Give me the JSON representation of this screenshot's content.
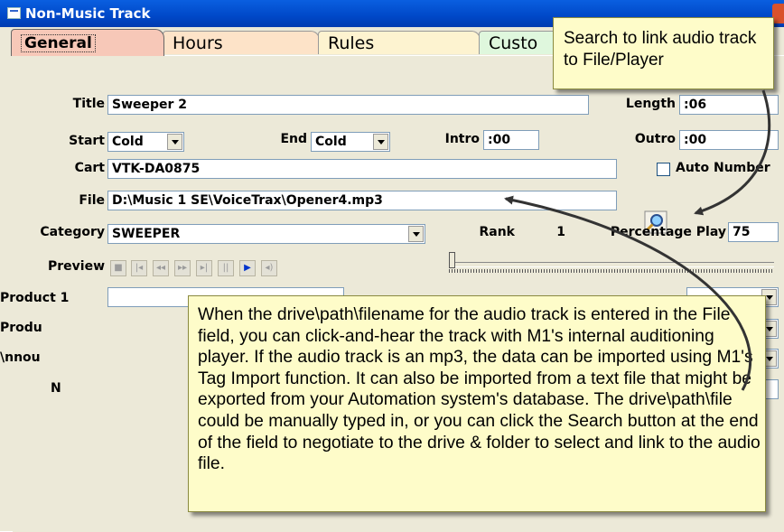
{
  "window": {
    "title": "Non-Music Track"
  },
  "tabs": [
    {
      "label": "General"
    },
    {
      "label": "Hours"
    },
    {
      "label": "Rules"
    },
    {
      "label": "Custo"
    }
  ],
  "form": {
    "title_label": "Title",
    "title_value": "Sweeper 2",
    "length_label": "Length",
    "length_value": ":06",
    "start_label": "Start",
    "start_value": "Cold",
    "end_label": "End",
    "end_value": "Cold",
    "intro_label": "Intro",
    "intro_value": ":00",
    "outro_label": "Outro",
    "outro_value": ":00",
    "cart_label": "Cart",
    "cart_value": "VTK-DA0875",
    "auto_number_label": "Auto Number",
    "file_label": "File",
    "file_value": "D:\\Music 1 SE\\VoiceTrax\\Opener4.mp3",
    "category_label": "Category",
    "category_value": "SWEEPER",
    "rank_label": "Rank",
    "rank_value": "1",
    "percentage_play_label": "Percentage Play",
    "percentage_play_value": "75",
    "preview_label": "Preview",
    "product1_label": "Product 1",
    "product2_label": "Produ",
    "announcer_label": "\\nnou",
    "notes_label": "N"
  },
  "icons": {
    "search": "magnifier-icon",
    "preview_buttons": [
      "stop-icon",
      "first-icon",
      "rewind-icon",
      "fast-forward-icon",
      "last-icon",
      "pause-icon",
      "play-icon",
      "mute-icon"
    ]
  },
  "callouts": {
    "search_tip": "Search to link audio track to File/Player",
    "file_tip": "When the drive\\path\\filename for the audio track is entered in the File field, you can click-and-hear the track with M1's internal auditioning player.  If the audio track is an mp3, the data can be imported using M1's Tag Import function.  It can also be imported from a text file that might be exported from your Automation system's database. The drive\\path\\file could be manually typed in, or you can click the Search button at the end of the field to negotiate to the drive & folder to select and link to the audio file."
  },
  "colors": {
    "titlebar": "#0048c8",
    "callout_bg": "#fefcc9",
    "tab_general": "#f7c8b8",
    "tab_hours": "#fde3c8",
    "tab_rules": "#fdf3d0",
    "tab_custom": "#dff7dd"
  }
}
